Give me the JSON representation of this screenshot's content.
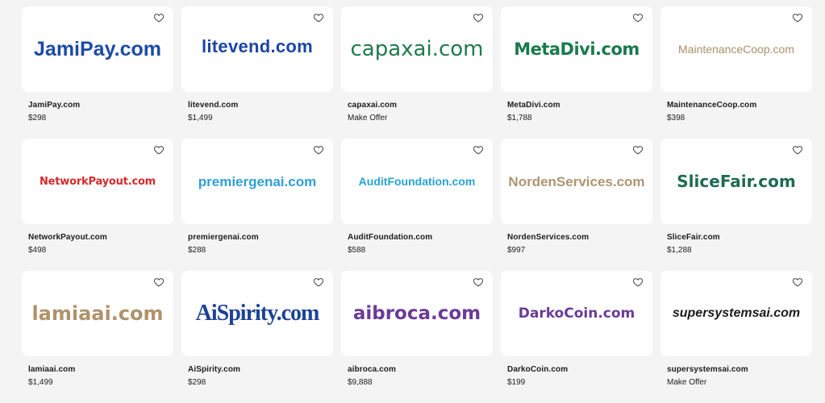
{
  "listings": [
    {
      "logo": "JamiPay.com",
      "name": "JamiPay.com",
      "price": "$298",
      "style": "s-jami"
    },
    {
      "logo": "litevend.com",
      "name": "litevend.com",
      "price": "$1,499",
      "style": "s-lite"
    },
    {
      "logo": "capaxai.com",
      "name": "capaxai.com",
      "price": "Make Offer",
      "style": "s-capa"
    },
    {
      "logo": "MetaDivi.com",
      "name": "MetaDivi.com",
      "price": "$1,788",
      "style": "s-meta"
    },
    {
      "logo": "MaintenanceCoop.com",
      "name": "MaintenanceCoop.com",
      "price": "$398",
      "style": "s-main"
    },
    {
      "logo": "NetworkPayout.com",
      "name": "NetworkPayout.com",
      "price": "$498",
      "style": "s-netw"
    },
    {
      "logo": "premiergenai.com",
      "name": "premiergenai.com",
      "price": "$288",
      "style": "s-prem"
    },
    {
      "logo": "AuditFoundation.com",
      "name": "AuditFoundation.com",
      "price": "$588",
      "style": "s-audi"
    },
    {
      "logo": "NordenServices.com",
      "name": "NordenServices.com",
      "price": "$997",
      "style": "s-nord"
    },
    {
      "logo": "SliceFair.com",
      "name": "SliceFair.com",
      "price": "$1,288",
      "style": "s-slic"
    },
    {
      "logo": "lamiaai.com",
      "name": "lamiaai.com",
      "price": "$1,499",
      "style": "s-lami"
    },
    {
      "logo": "AiSpirity.com",
      "name": "AiSpirity.com",
      "price": "$298",
      "style": "s-aisp"
    },
    {
      "logo": "aibroca.com",
      "name": "aibroca.com",
      "price": "$9,888",
      "style": "s-aibr"
    },
    {
      "logo": "DarkoCoin.com",
      "name": "DarkoCoin.com",
      "price": "$199",
      "style": "s-dark"
    },
    {
      "logo": "supersystemsai.com",
      "name": "supersystemsai.com",
      "price": "Make Offer",
      "style": "s-supe"
    }
  ],
  "icons": {
    "favorite": "heart-outline-icon"
  },
  "colors": {
    "background": "#f4f4f4",
    "card": "#ffffff",
    "text": "#1d1d1f"
  }
}
